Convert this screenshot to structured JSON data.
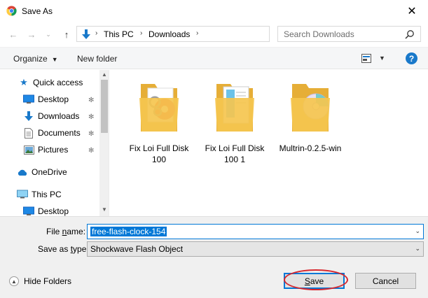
{
  "window": {
    "title": "Save As",
    "close_glyph": "✕"
  },
  "address_bar": {
    "breadcrumbs": [
      "This PC",
      "Downloads"
    ],
    "search_placeholder": "Search Downloads"
  },
  "command_bar": {
    "organize_label": "Organize",
    "new_folder_label": "New folder",
    "help_label": "?"
  },
  "nav_pane": {
    "items": [
      {
        "label": "Quick access",
        "icon": "star-icon"
      },
      {
        "label": "Desktop",
        "icon": "desktop-icon",
        "pinned": true
      },
      {
        "label": "Downloads",
        "icon": "download-icon",
        "pinned": true
      },
      {
        "label": "Documents",
        "icon": "document-icon",
        "pinned": true
      },
      {
        "label": "Pictures",
        "icon": "pictures-icon",
        "pinned": true
      },
      {
        "label": "OneDrive",
        "icon": "cloud-icon"
      },
      {
        "label": "This PC",
        "icon": "computer-icon"
      },
      {
        "label": "Desktop",
        "icon": "desktop-icon"
      }
    ]
  },
  "files": [
    {
      "name": "Fix Loi Full Disk 100",
      "thumb": "installer"
    },
    {
      "name": "Fix Loi Full Disk 100 1",
      "thumb": "document"
    },
    {
      "name": "Multrin-0.2.5-win",
      "thumb": "disc"
    }
  ],
  "form": {
    "file_name_label_prefix": "File ",
    "file_name_label_key": "n",
    "file_name_label_suffix": "ame:",
    "file_name_value": "free-flash-clock-154",
    "save_type_label_prefix": "Save as ",
    "save_type_label_key": "t",
    "save_type_label_suffix": "ype:",
    "save_type_value": "Shockwave Flash Object"
  },
  "footer": {
    "hide_folders_label": "Hide Folders",
    "save_label_key": "S",
    "save_label_rest": "ave",
    "cancel_label": "Cancel"
  },
  "colors": {
    "accent": "#0078d7",
    "folder": "#f5c64f",
    "highlight_ring": "#d6272e"
  }
}
